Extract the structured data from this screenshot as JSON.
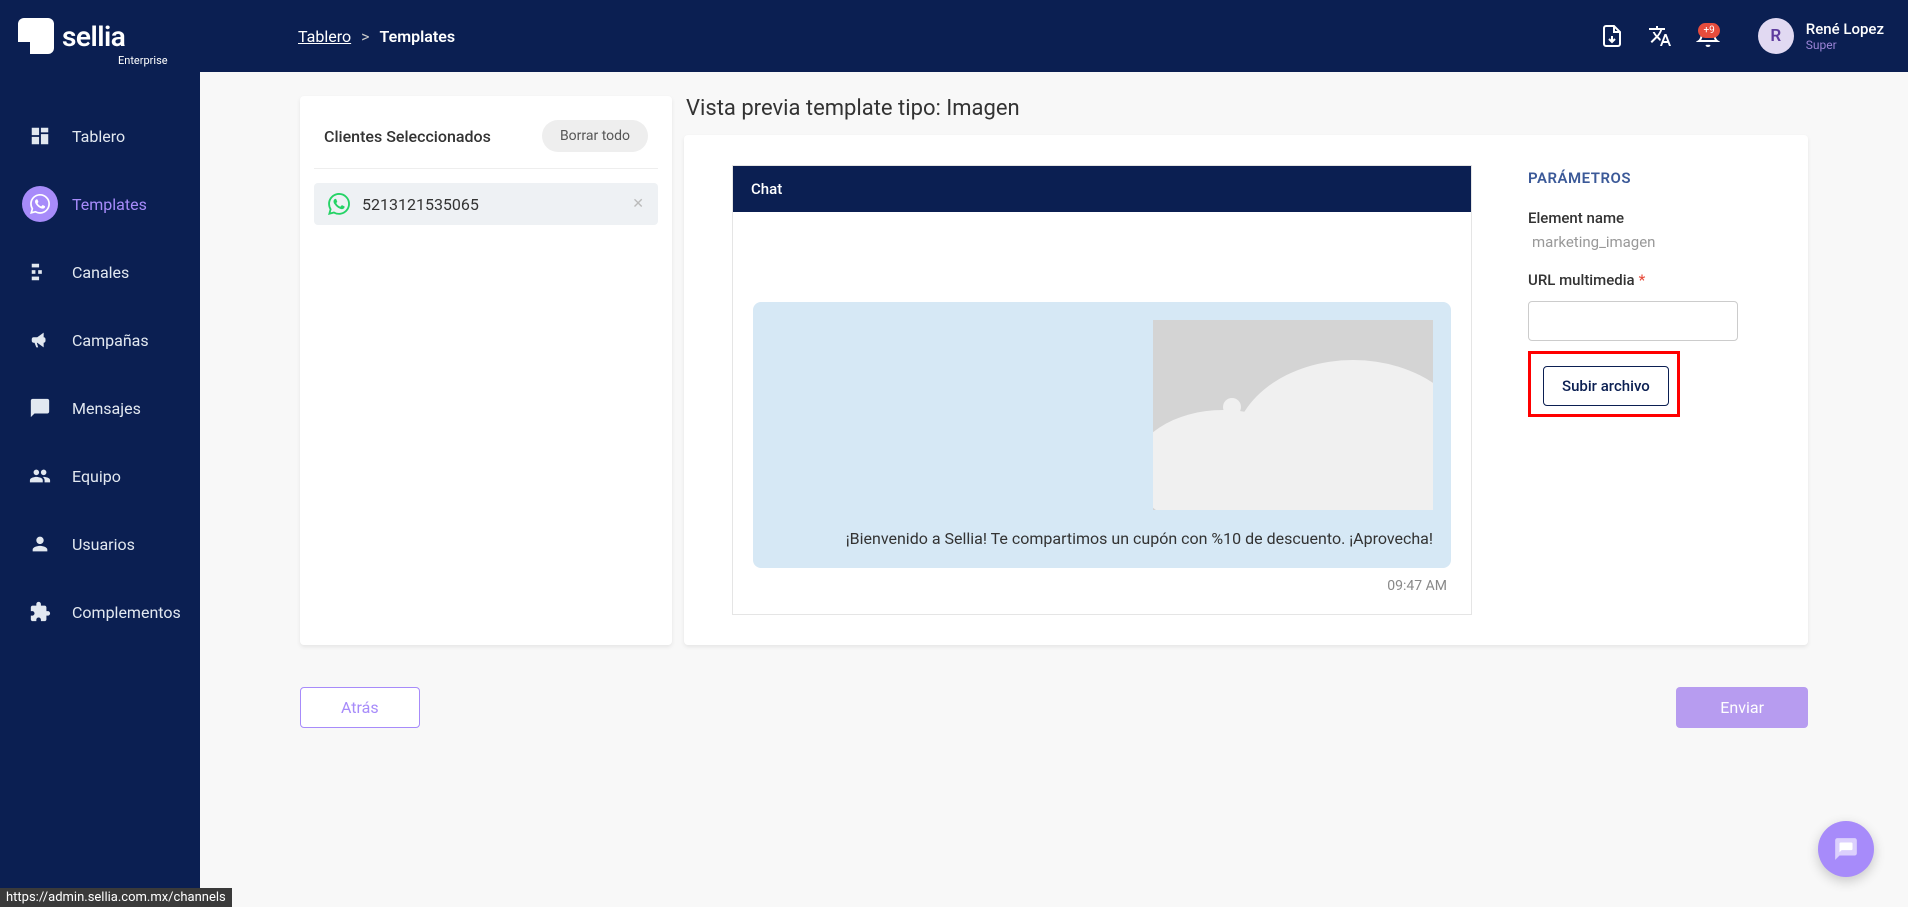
{
  "brand": {
    "name": "sellia",
    "sub": "Enterprise"
  },
  "breadcrumb": {
    "root": "Tablero",
    "sep": ">",
    "current": "Templates"
  },
  "header": {
    "notif_count": "+9",
    "user_name": "René Lopez",
    "user_role": "Super",
    "avatar_initial": "R"
  },
  "sidebar": {
    "items": [
      {
        "label": "Tablero",
        "icon": "dashboard"
      },
      {
        "label": "Templates",
        "icon": "whatsapp",
        "active": true
      },
      {
        "label": "Canales",
        "icon": "channels"
      },
      {
        "label": "Campañas",
        "icon": "megaphone"
      },
      {
        "label": "Mensajes",
        "icon": "message"
      },
      {
        "label": "Equipo",
        "icon": "team"
      },
      {
        "label": "Usuarios",
        "icon": "user"
      },
      {
        "label": "Complementos",
        "icon": "plugin"
      }
    ]
  },
  "clients": {
    "title": "Clientes Seleccionados",
    "clear": "Borrar todo",
    "items": [
      {
        "number": "5213121535065"
      }
    ]
  },
  "preview": {
    "title": "Vista previa template tipo: Imagen",
    "chat_label": "Chat",
    "message_text": "¡Bienvenido a Sellia! Te compartimos un cupón con %10 de descuento. ¡Aprovecha!",
    "time": "09:47 AM"
  },
  "params": {
    "title": "PARÁMETROS",
    "element_label": "Element name",
    "element_value": "marketing_imagen",
    "url_label": "URL multimedia",
    "upload_label": "Subir archivo"
  },
  "footer": {
    "back": "Atrás",
    "send": "Enviar"
  },
  "status_url": "https://admin.sellia.com.mx/channels"
}
